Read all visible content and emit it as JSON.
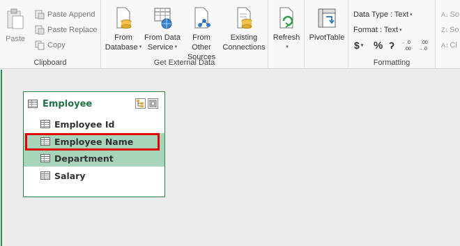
{
  "ribbon": {
    "clipboard": {
      "label": "Clipboard",
      "paste": "Paste",
      "paste_append": "Paste Append",
      "paste_replace": "Paste Replace",
      "copy": "Copy"
    },
    "external": {
      "label": "Get External Data",
      "from_database": [
        "From",
        "Database"
      ],
      "from_data_service": [
        "From Data",
        "Service"
      ],
      "from_other_sources": [
        "From Other",
        "Sources"
      ],
      "existing_connections": [
        "Existing",
        "Connections"
      ]
    },
    "refresh": {
      "label": "Refresh"
    },
    "pivot": {
      "label": "PivotTable"
    },
    "formatting": {
      "label": "Formatting",
      "data_type": "Data Type : Text",
      "format": "Format : Text",
      "dollar": "$",
      "percent": "%",
      "comma": "ʔ",
      "inc_dec": "←.0 .00",
      "dec_dec": ".00 →.0"
    },
    "sort": {
      "sort_a": "So",
      "sort_z": "So",
      "clear": "Cl"
    }
  },
  "diagram": {
    "table": {
      "title": "Employee",
      "fields": [
        "Employee Id",
        "Employee Name",
        "Department",
        "Salary"
      ]
    }
  },
  "colors": {
    "accent": "#217346",
    "selection": "#a7d5b9",
    "highlight": "#e00000"
  }
}
